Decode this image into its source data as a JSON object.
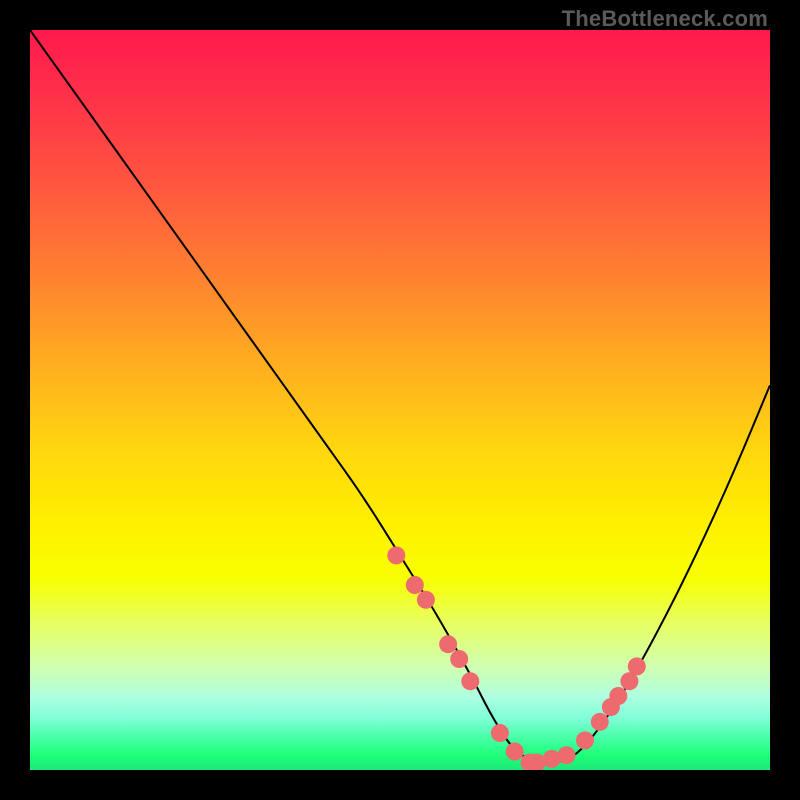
{
  "watermark": "TheBottleneck.com",
  "chart_data": {
    "type": "line",
    "title": "",
    "xlabel": "",
    "ylabel": "",
    "xlim": [
      0,
      100
    ],
    "ylim": [
      0,
      100
    ],
    "series": [
      {
        "name": "bottleneck-curve",
        "x": [
          0,
          5,
          10,
          15,
          20,
          25,
          30,
          35,
          40,
          45,
          50,
          55,
          60,
          62,
          65,
          68,
          72,
          75,
          80,
          85,
          90,
          95,
          100
        ],
        "y": [
          100,
          93,
          86,
          79,
          72,
          65,
          58,
          51,
          44,
          37,
          29,
          21,
          12,
          8,
          3,
          1,
          1,
          3,
          10,
          19,
          29,
          40,
          52
        ]
      }
    ],
    "markers": {
      "name": "highlight-dots",
      "color": "#ed6b6e",
      "x": [
        49.5,
        52.0,
        53.5,
        56.5,
        58.0,
        59.5,
        63.5,
        65.5,
        67.5,
        68.5,
        70.5,
        72.5,
        75.0,
        77.0,
        78.5,
        79.5,
        81.0,
        82.0
      ],
      "y": [
        29.0,
        25.0,
        23.0,
        17.0,
        15.0,
        12.0,
        5.0,
        2.5,
        1.0,
        1.0,
        1.5,
        2.0,
        4.0,
        6.5,
        8.5,
        10.0,
        12.0,
        14.0
      ]
    },
    "gradient_stops": [
      {
        "pos": 0,
        "color": "#ff1a4d"
      },
      {
        "pos": 50,
        "color": "#ffd400"
      },
      {
        "pos": 80,
        "color": "#f0ff40"
      },
      {
        "pos": 100,
        "color": "#1ee878"
      }
    ]
  }
}
